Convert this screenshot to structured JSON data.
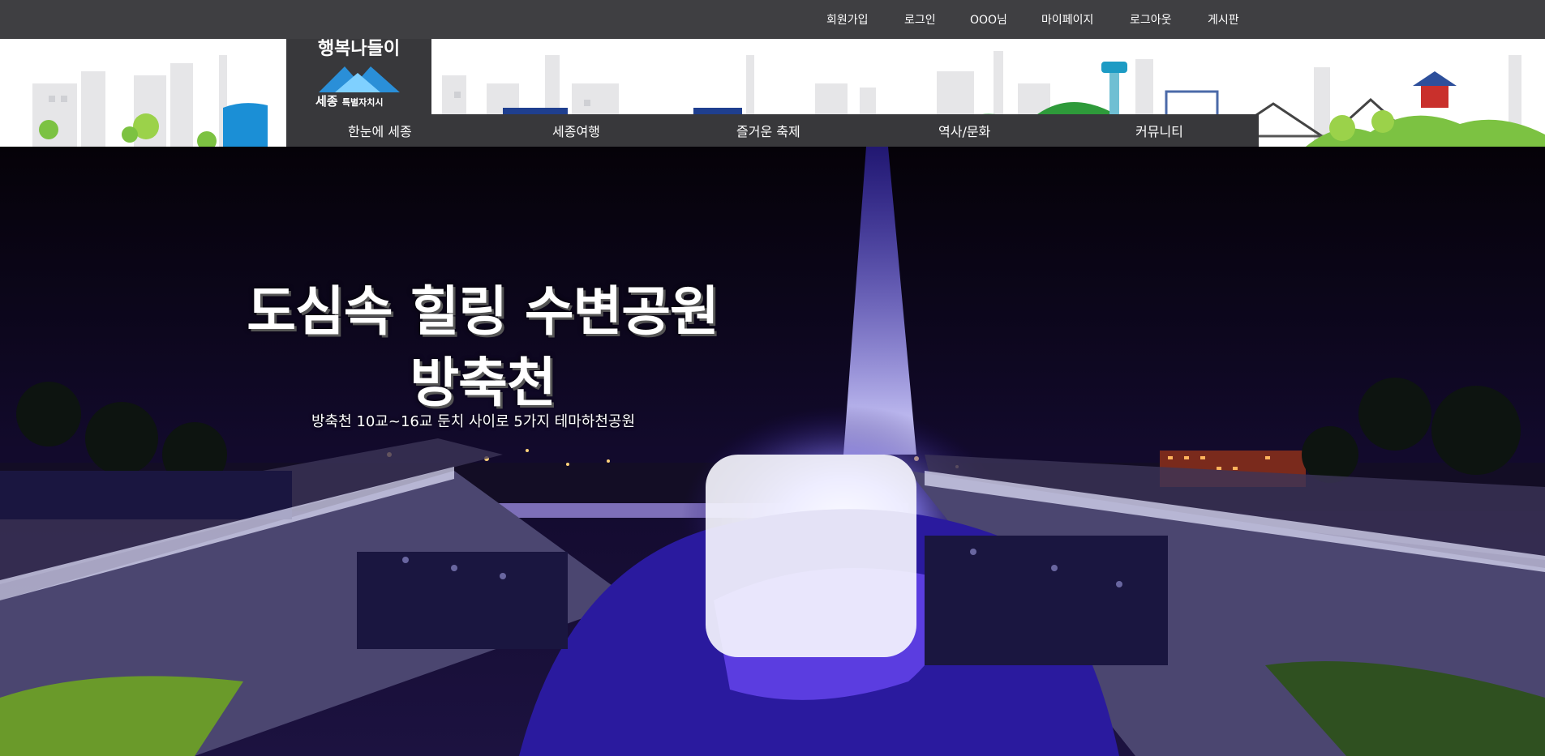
{
  "utility_nav": [
    "회원가입",
    "로그인",
    "OOO님",
    "마이페이지",
    "로그아웃",
    "게시판"
  ],
  "logo": {
    "title": "행복나들이",
    "city": "세종",
    "city_sub": "특별자치시"
  },
  "main_nav": [
    "한눈에 세종",
    "세종여행",
    "즐거운 축제",
    "역사/문화",
    "커뮤니티"
  ],
  "hero": {
    "title_line1": "도심속 힐링 수변공원",
    "title_line2": "방축천",
    "subtitle": "방축천 10교~16교 둔치 사이로 5가지 테마하천공원"
  },
  "colors": {
    "topbar": "#3f3f42",
    "nav": "#38383b",
    "hero_bg": "#0a0714",
    "fountain": "#4a3dff"
  }
}
